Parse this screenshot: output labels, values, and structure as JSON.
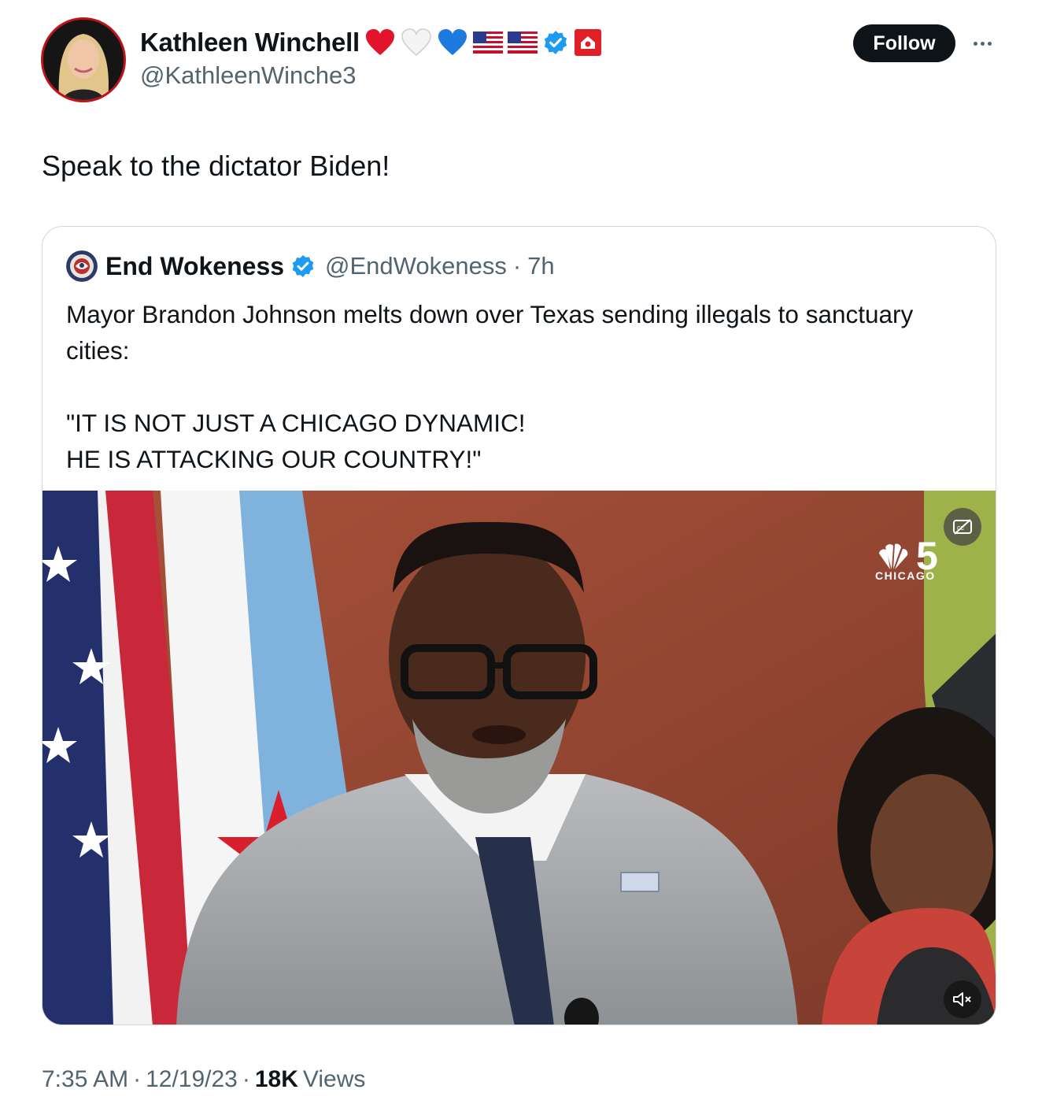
{
  "author": {
    "display_name": "Kathleen Winchell",
    "handle": "@KathleenWinche3",
    "badges": [
      "red-heart",
      "white-heart",
      "blue-heart",
      "us-flag",
      "us-flag",
      "verified-badge",
      "home-badge"
    ]
  },
  "actions": {
    "follow_label": "Follow"
  },
  "tweet": {
    "text": "Speak to the dictator Biden!"
  },
  "quoted": {
    "display_name": "End Wokeness",
    "handle": "@EndWokeness",
    "separator": "·",
    "time": "7h",
    "text": "Mayor Brandon Johnson melts down over Texas sending illegals to sanctuary cities:\n\n\"IT IS NOT JUST A CHICAGO DYNAMIC!\nHE IS ATTACKING OUR COUNTRY!\"",
    "media": {
      "type": "video",
      "watermark_text": "CHICAGO",
      "watermark_number": "5"
    }
  },
  "meta": {
    "time": "7:35 AM",
    "sep1": "·",
    "date": "12/19/23",
    "sep2": "·",
    "views_count": "18K",
    "views_label": "Views"
  },
  "colors": {
    "accent_verified": "#1d9bf0",
    "follow_bg": "#0f1419",
    "secondary_text": "#536471",
    "border": "#cfd9de"
  }
}
